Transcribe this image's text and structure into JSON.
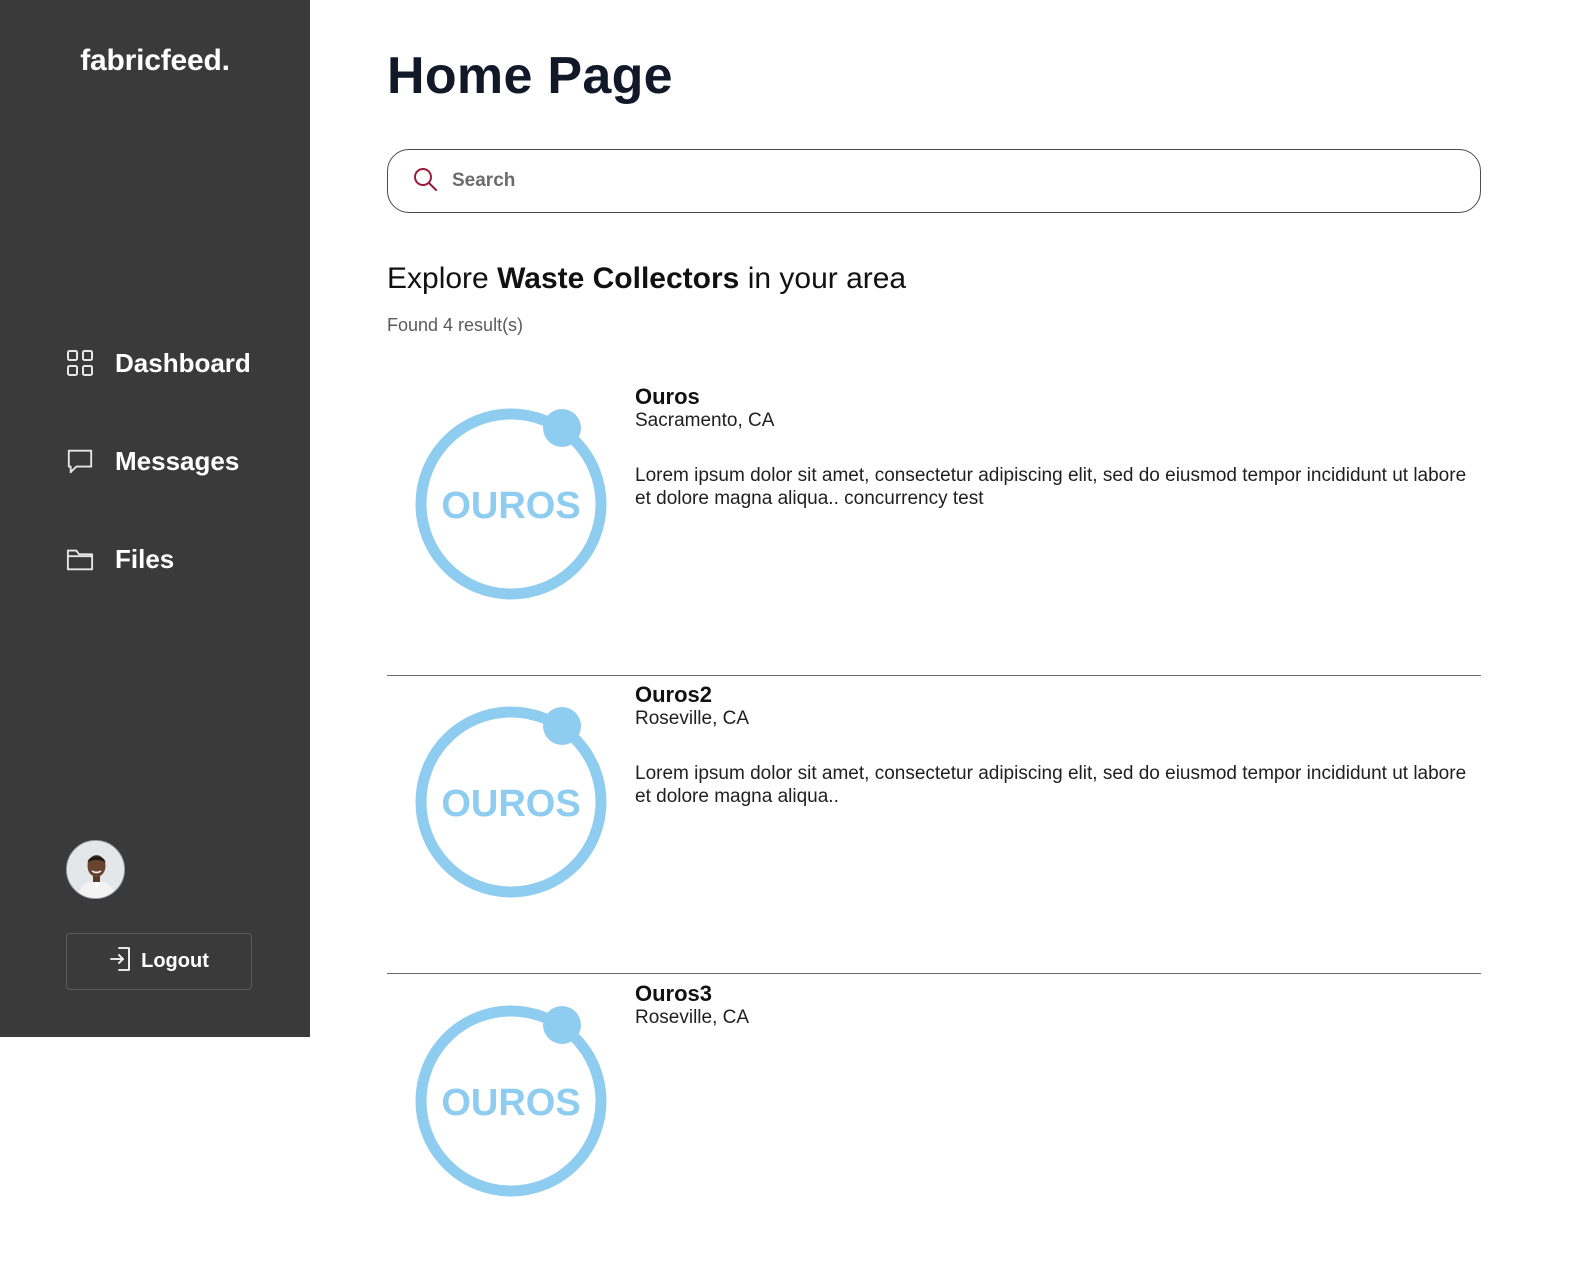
{
  "brand": {
    "name": "fabricfeed."
  },
  "sidebar": {
    "items": [
      {
        "label": "Dashboard",
        "icon": "grid-icon"
      },
      {
        "label": "Messages",
        "icon": "chat-bubble-icon"
      },
      {
        "label": "Files",
        "icon": "folder-icon"
      }
    ],
    "logout_label": "Logout"
  },
  "page": {
    "title": "Home Page",
    "search_placeholder": "Search",
    "heading_prefix": "Explore ",
    "heading_bold": "Waste Collectors",
    "heading_suffix": " in your area",
    "results_count": "Found 4 result(s)"
  },
  "results": [
    {
      "name": "Ouros",
      "location": "Sacramento, CA",
      "description": "Lorem ipsum dolor sit amet, consectetur adipiscing elit, sed do eiusmod tempor incididunt ut labore et dolore magna aliqua.. concurrency test",
      "logo_text": "OUROS"
    },
    {
      "name": "Ouros2",
      "location": "Roseville, CA",
      "description": "Lorem ipsum dolor sit amet, consectetur adipiscing elit, sed do eiusmod tempor incididunt ut labore et dolore magna aliqua..",
      "logo_text": "OUROS"
    },
    {
      "name": "Ouros3",
      "location": "Roseville, CA",
      "description": "",
      "logo_text": "OUROS"
    }
  ],
  "colors": {
    "sidebar_bg": "#3a3a3a",
    "logo_blue": "#8ecdf0",
    "search_icon": "#9b1b3a"
  }
}
